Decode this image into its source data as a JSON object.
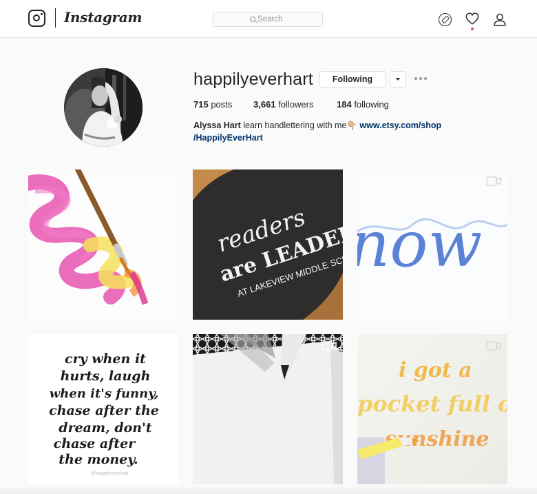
{
  "nav": {
    "logo_text": "Instagram",
    "search_placeholder": "Search",
    "icons": [
      "instagram-logo-icon",
      "search-icon",
      "compass-icon",
      "heart-icon",
      "profile-icon"
    ],
    "notification_dot_color": "#ed4956"
  },
  "profile": {
    "username": "happilyeverhart",
    "follow_label": "Following",
    "stats": {
      "posts_count": "715",
      "posts_label": " posts",
      "followers_count": "3,661",
      "followers_label": " followers",
      "following_count": "184",
      "following_label": " following"
    },
    "bio": {
      "name": "Alyssa Hart",
      "text": " learn handlettering with me👇🏼 ",
      "link_line1": "www.etsy.com/shop",
      "link_line2": "/HappilyEverHart"
    }
  },
  "posts": [
    {
      "description": "pink and yellow watercolor loops with paintbrush",
      "video": true
    },
    {
      "description": "chalkboard lettering",
      "lettering": [
        "readers",
        "are LEADERS",
        "AT LAKEVIEW MIDDLE SCHOOL"
      ],
      "video": false
    },
    {
      "description": "blue watercolor brush lettering",
      "lettering": [
        "now"
      ],
      "video": true
    },
    {
      "description": "black brush lettering quote",
      "lettering": [
        "cry when it",
        "hurts, laugh",
        "when it's funny,",
        "chase after the",
        "dream, don't",
        "chase after",
        "the money."
      ],
      "watermark": "@happilyeverhart",
      "video": false
    },
    {
      "description": "pen on white paper over patterned background",
      "video": true
    },
    {
      "description": "yellow orange brush pen lettering",
      "lettering": [
        "i got a",
        "pocket full of",
        "sunshine"
      ],
      "video": true
    }
  ],
  "colors": {
    "link": "#003569",
    "text": "#262626",
    "border": "#dbdbdb",
    "background": "#fafafa"
  }
}
